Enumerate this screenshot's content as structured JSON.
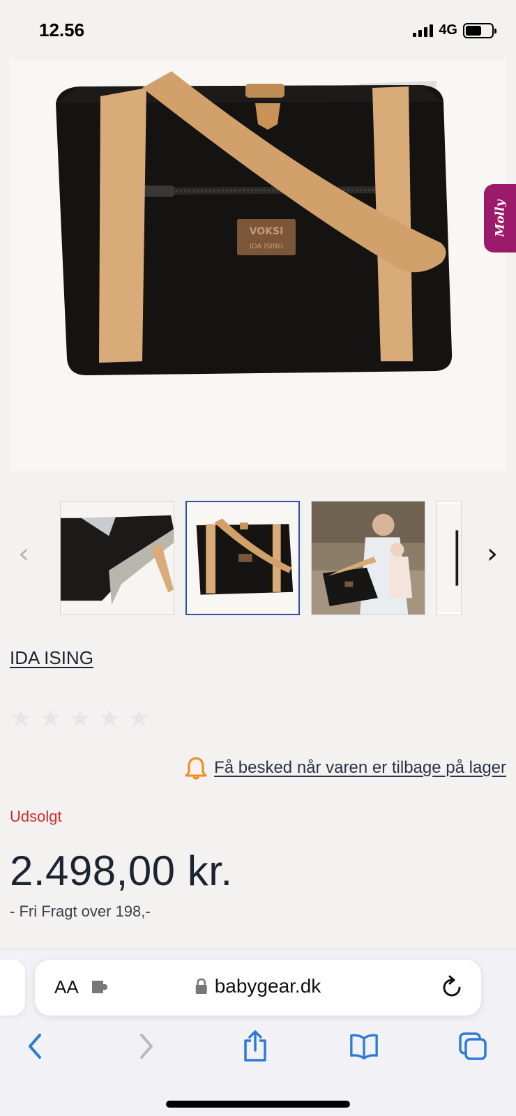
{
  "status_bar": {
    "time": "12.56",
    "network": "4G",
    "battery_level": 0.6
  },
  "hero": {
    "image_name": "black canvas tote bag with leather straps",
    "badge_line1": "VOKSI",
    "badge_line2": "IDA ISING",
    "side_tab_label": "Molly"
  },
  "gallery": {
    "prev_arrow": "‹",
    "next_arrow": "›",
    "thumbnails": [
      {
        "name": "bag-detail-thumbnail",
        "selected": false
      },
      {
        "name": "bag-front-thumbnail",
        "selected": true
      },
      {
        "name": "man-with-baby-thumbnail",
        "selected": false
      },
      {
        "name": "partial-thumbnail",
        "selected": false
      }
    ]
  },
  "product": {
    "brand": "IDA ISING",
    "rating": {
      "stars_total": 5,
      "stars_filled": 0
    },
    "notify_text": "Få besked når varen er tilbage på lager",
    "stock_status": "Udsolgt",
    "price": "2.498,00 kr.",
    "shipping_note": "- Fri Fragt over 198,-"
  },
  "browser": {
    "text_size_label": "AA",
    "domain": "babygear.dk",
    "icons": [
      "text-size-icon",
      "extension-icon",
      "lock-icon",
      "reload-icon",
      "back-icon",
      "forward-icon",
      "share-icon",
      "bookmarks-icon",
      "tabs-icon"
    ]
  },
  "colors": {
    "sold_out": "#d12b2b",
    "accent_blue": "#2e7bd6",
    "bell_orange": "#f08a24",
    "molly_tab": "#9c1a6a",
    "selected_border": "#2e4e9e"
  }
}
